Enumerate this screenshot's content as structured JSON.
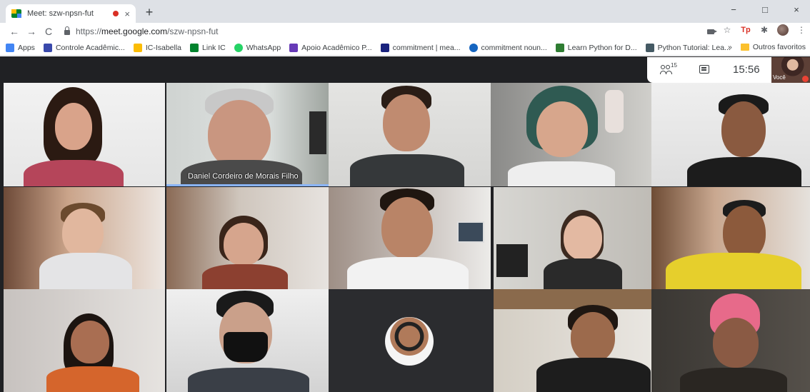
{
  "browser": {
    "tab_title": "Meet: szw-npsn-fut",
    "close_glyph": "×",
    "newtab_glyph": "+",
    "win_min": "−",
    "win_max": "□",
    "win_close": "×",
    "nav_back": "←",
    "nav_forward": "→",
    "nav_reload": "C",
    "url_scheme": "https://",
    "url_host": "meet.google.com",
    "url_path": "/szw-npsn-fut",
    "star_glyph": "☆",
    "tp_label": "Tp",
    "ext_glyph": "✱",
    "menu_glyph": "⋮"
  },
  "bookmarks": {
    "items": [
      {
        "label": "Apps",
        "color": "#4285f4"
      },
      {
        "label": "Controle Acadêmic...",
        "color": "#3949ab"
      },
      {
        "label": "IC-Isabella",
        "color": "#fbbc04"
      },
      {
        "label": "Link IC",
        "color": "#00832d"
      },
      {
        "label": "WhatsApp",
        "color": "#25d366"
      },
      {
        "label": "Apoio Acadêmico P...",
        "color": "#673ab7"
      },
      {
        "label": "commitment | mea...",
        "color": "#1a237e"
      },
      {
        "label": "commitment noun...",
        "color": "#1565c0"
      },
      {
        "label": "Learn Python for D...",
        "color": "#2e7d32"
      },
      {
        "label": "Python Tutorial: Lea...",
        "color": "#455a64"
      }
    ],
    "overflow": "»",
    "other_label": "Outros favoritos"
  },
  "meet": {
    "participant_count": "15",
    "time": "15:56",
    "self_label": "Você",
    "speaker_name": "Daniel Cordeiro de Morais Filho"
  }
}
